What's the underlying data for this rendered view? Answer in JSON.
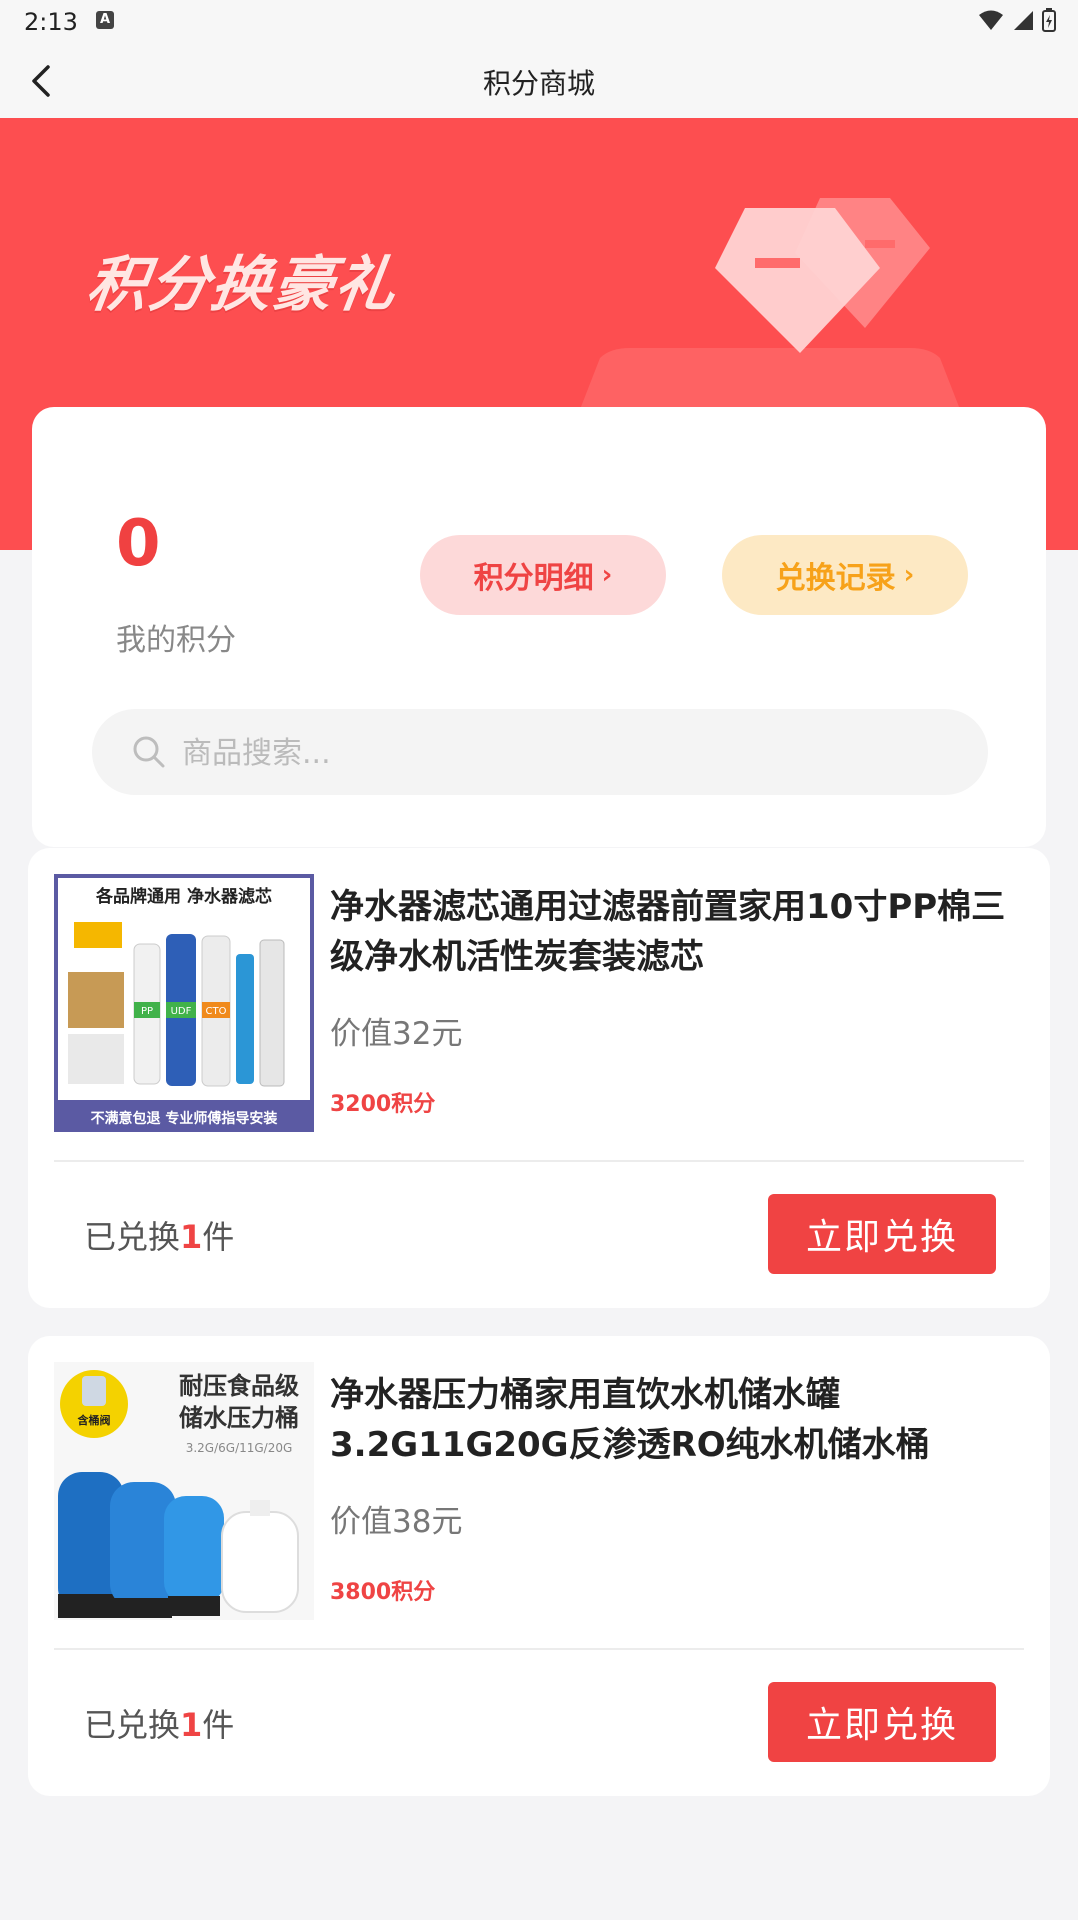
{
  "status_bar": {
    "time": "2:13",
    "notification": "A"
  },
  "nav": {
    "title": "积分商城"
  },
  "banner": {
    "slogan": "积分换豪礼"
  },
  "points": {
    "value": "0",
    "label": "我的积分",
    "detail_button": "积分明细",
    "record_button": "兑换记录",
    "chevron": "›"
  },
  "search": {
    "placeholder": "商品搜索..."
  },
  "colors": {
    "accent": "#f04141",
    "banner": "#fd4e50",
    "gold": "#f7a21a"
  },
  "products": [
    {
      "title": "净水器滤芯通用过滤器前置家用10寸PP棉三级净水机活性炭套装滤芯",
      "value": "价值32元",
      "points": "3200积分",
      "count_prefix": "已兑换",
      "count_num": "1",
      "count_suffix": "件",
      "button": "立即兑换",
      "thumb": {
        "header": "各品牌通用 净水器滤芯",
        "tagline": "不满意包退  专业师傅指导安装",
        "filter_labels": [
          "PP",
          "UDF",
          "CTO"
        ]
      }
    },
    {
      "title": "净水器压力桶家用直饮水机储水罐3.2G11G20G反渗透RO纯水机储水桶",
      "value": "价值38元",
      "points": "3800积分",
      "count_prefix": "已兑换",
      "count_num": "1",
      "count_suffix": "件",
      "button": "立即兑换",
      "thumb": {
        "header_1": "耐压食品级",
        "header_2": "储水压力桶",
        "sizes": "3.2G/6G/11G/20G",
        "badge": "含桶阀"
      }
    }
  ]
}
